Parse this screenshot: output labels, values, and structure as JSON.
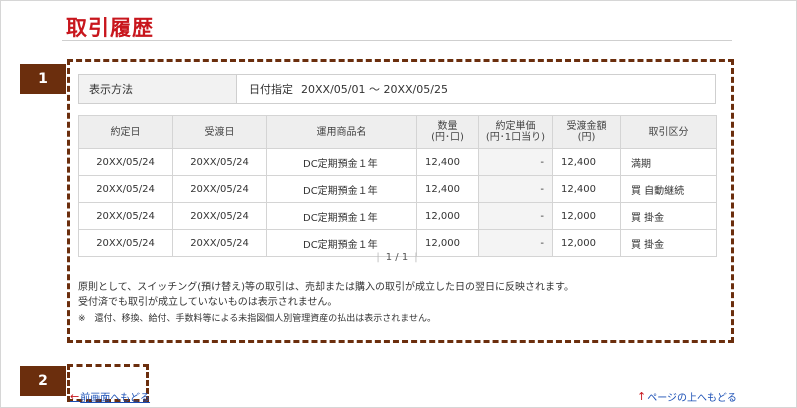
{
  "page": {
    "title": "取引履歴"
  },
  "badges": [
    "1",
    "2"
  ],
  "display_method": {
    "label": "表示方法",
    "mode": "日付指定",
    "range": "20XX/05/01 ～ 20XX/05/25"
  },
  "table": {
    "headers": [
      {
        "main": "約定日",
        "sub": ""
      },
      {
        "main": "受渡日",
        "sub": ""
      },
      {
        "main": "運用商品名",
        "sub": ""
      },
      {
        "main": "数量",
        "sub": "(円･口)"
      },
      {
        "main": "約定単価",
        "sub": "(円･1口当り)"
      },
      {
        "main": "受渡金額",
        "sub": "(円)"
      },
      {
        "main": "取引区分",
        "sub": ""
      }
    ],
    "rows": [
      [
        "20XX/05/24",
        "20XX/05/24",
        "DC定期預金１年",
        "12,400",
        "-",
        "12,400",
        "満期"
      ],
      [
        "20XX/05/24",
        "20XX/05/24",
        "DC定期預金１年",
        "12,400",
        "-",
        "12,400",
        "買 自動継続"
      ],
      [
        "20XX/05/24",
        "20XX/05/24",
        "DC定期預金１年",
        "12,000",
        "-",
        "12,000",
        "買 掛金"
      ],
      [
        "20XX/05/24",
        "20XX/05/24",
        "DC定期預金１年",
        "12,000",
        "-",
        "12,000",
        "買 掛金"
      ]
    ]
  },
  "pager": {
    "text": "1 / 1"
  },
  "notes": {
    "line1": "原則として、スイッチング(預け替え)等の取引は、売却または購入の取引が成立した日の翌日に反映されます。",
    "line2": "受付済でも取引が成立していないものは表示されません。",
    "line3": "※　還付、移換、給付、手数料等による未指図個人別管理資産の払出は表示されません。"
  },
  "links": {
    "back": "前画面へもどる",
    "top": "ページの上へもどる"
  },
  "icons": {
    "back": "arrow-left-icon",
    "top": "arrow-up-icon"
  },
  "colors": {
    "title": "#c8161d",
    "badge": "#6b2e0d",
    "link": "#1a4fb5"
  }
}
